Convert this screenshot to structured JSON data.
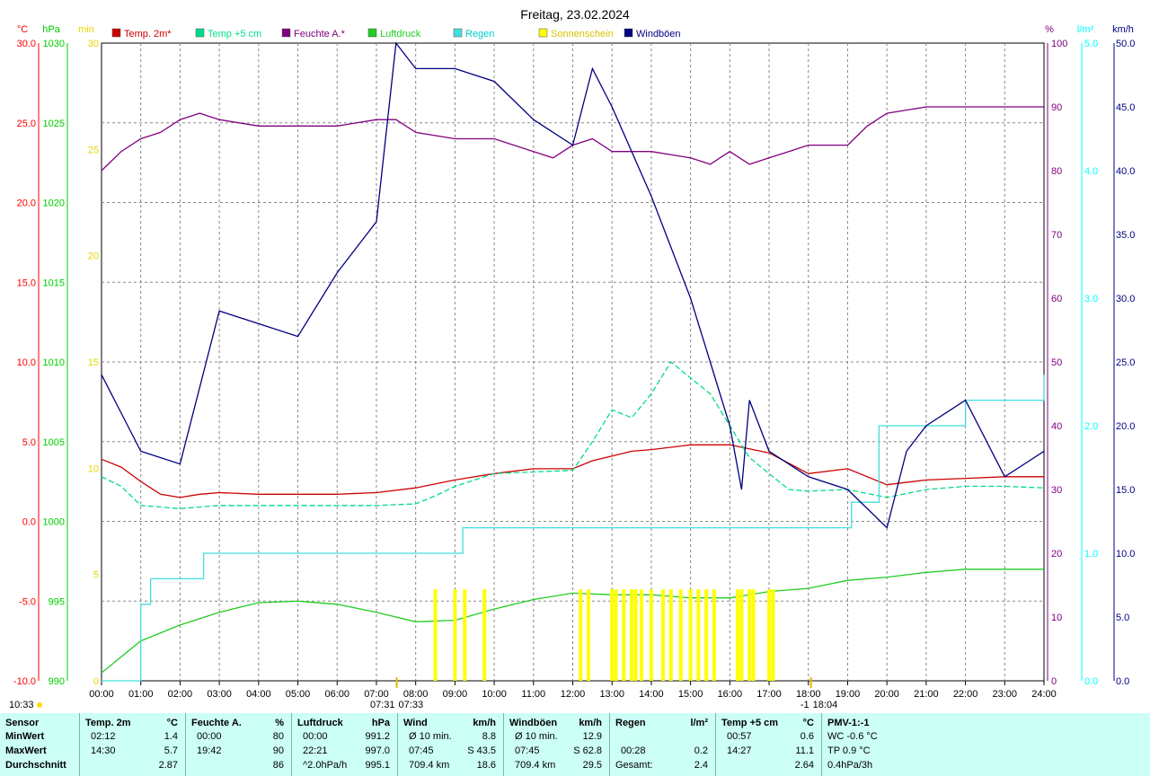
{
  "chart_data": {
    "type": "line",
    "title": "Freitag, 23.02.2024",
    "x_ticks": [
      "00:00",
      "01:00",
      "02:00",
      "03:00",
      "04:00",
      "05:00",
      "06:00",
      "07:00",
      "08:00",
      "09:00",
      "10:00",
      "11:00",
      "12:00",
      "13:00",
      "14:00",
      "15:00",
      "16:00",
      "17:00",
      "18:00",
      "19:00",
      "20:00",
      "21:00",
      "22:00",
      "23:00",
      "24:00"
    ],
    "x_range_hours": [
      0,
      24
    ],
    "grid": true,
    "legend_position": "top",
    "axes": {
      "temp": {
        "unit": "°C",
        "min": -10,
        "max": 30,
        "ticks": [
          "30.0",
          "25.0",
          "20.0",
          "15.0",
          "10.0",
          "5.0",
          "0.0",
          "-5.0",
          "-10.0"
        ],
        "color": "#ff0000"
      },
      "pressure": {
        "unit": "hPa",
        "min": 990,
        "max": 1030,
        "ticks": [
          "1030",
          "1025",
          "1020",
          "1015",
          "1010",
          "1005",
          "1000",
          "995",
          "990"
        ],
        "color": "#00cc00"
      },
      "sun": {
        "unit": "min",
        "min": 0,
        "max": 30,
        "ticks": [
          "30",
          "25",
          "20",
          "15",
          "10",
          "5",
          "0"
        ],
        "color": "#e6d600"
      },
      "humidity": {
        "unit": "%",
        "min": 0,
        "max": 100,
        "ticks": [
          "100",
          "90",
          "80",
          "70",
          "60",
          "50",
          "40",
          "30",
          "20",
          "10",
          "0"
        ],
        "color": "#800080"
      },
      "rain": {
        "unit": "l/m²",
        "min": 0,
        "max": 5,
        "ticks": [
          "5.0",
          "4.0",
          "3.0",
          "2.0",
          "1.0",
          "0.0"
        ],
        "color": "#00ffff"
      },
      "wind": {
        "unit": "km/h",
        "min": 0,
        "max": 50,
        "ticks": [
          "50.0",
          "45.0",
          "40.0",
          "35.0",
          "30.0",
          "25.0",
          "20.0",
          "15.0",
          "10.0",
          "5.0",
          "0.0"
        ],
        "color": "#000080"
      }
    },
    "sun_markers": {
      "sunrise": "07:31",
      "noon": "07:33",
      "sunset": "18:04",
      "sunset_prefix": "-1",
      "left_time": "10:33"
    },
    "series": [
      {
        "name": "Temp. 2m*",
        "color": "#cc0000",
        "axis": "temp",
        "x": [
          0,
          0.5,
          1,
          1.5,
          2,
          2.5,
          3,
          4,
          5,
          6,
          7,
          8,
          9,
          10,
          11,
          12,
          12.5,
          13,
          13.5,
          14,
          15,
          16,
          17,
          18,
          19,
          20,
          21,
          22,
          23,
          24
        ],
        "values": [
          3.9,
          3.4,
          2.5,
          1.7,
          1.5,
          1.7,
          1.8,
          1.7,
          1.7,
          1.7,
          1.8,
          2.1,
          2.6,
          3,
          3.3,
          3.3,
          3.8,
          4.1,
          4.4,
          4.5,
          4.8,
          4.8,
          4.3,
          3,
          3.3,
          2.3,
          2.6,
          2.7,
          2.8,
          2.8
        ]
      },
      {
        "name": "Temp +5 cm",
        "color": "#00dd88",
        "axis": "temp",
        "x": [
          0,
          0.5,
          1,
          1.5,
          2,
          3,
          4,
          5,
          6,
          7,
          8,
          8.5,
          9,
          10,
          11,
          12,
          12.5,
          13,
          13.5,
          14,
          14.5,
          15,
          15.5,
          16,
          16.5,
          17,
          17.5,
          18,
          19,
          20,
          21,
          22,
          23,
          24
        ],
        "values": [
          2.8,
          2.2,
          1,
          0.9,
          0.8,
          1,
          1,
          1,
          1,
          1,
          1.1,
          1.6,
          2.2,
          3,
          3.1,
          3.2,
          5,
          7,
          6.5,
          8,
          10,
          9,
          8,
          6,
          4,
          3,
          2,
          1.9,
          2,
          1.5,
          2,
          2.2,
          2.2,
          2.1
        ]
      },
      {
        "name": "Feuchte A.*",
        "color": "#800080",
        "axis": "humidity",
        "x": [
          0,
          0.5,
          1,
          1.5,
          2,
          2.5,
          3,
          4,
          5,
          6,
          7,
          7.5,
          8,
          9,
          10,
          11,
          11.5,
          12,
          12.5,
          13,
          14,
          15,
          15.5,
          16,
          16.5,
          17,
          17.5,
          18,
          19,
          19.5,
          20,
          21,
          22,
          23,
          24
        ],
        "values": [
          80,
          83,
          85,
          86,
          88,
          89,
          88,
          87,
          87,
          87,
          88,
          88,
          86,
          85,
          85,
          83,
          82,
          84,
          85,
          83,
          83,
          82,
          81,
          83,
          81,
          82,
          83,
          84,
          84,
          87,
          89,
          90,
          90,
          90,
          90
        ]
      },
      {
        "name": "Luftdruck",
        "color": "#22cc22",
        "axis": "pressure",
        "x": [
          0,
          1,
          2,
          3,
          4,
          5,
          6,
          7,
          8,
          9,
          10,
          11,
          12,
          13,
          14,
          15,
          16,
          17,
          18,
          19,
          20,
          21,
          22,
          23,
          24
        ],
        "values": [
          990.5,
          992.5,
          993.5,
          994.3,
          994.9,
          995,
          994.8,
          994.3,
          993.7,
          993.8,
          994.5,
          995.1,
          995.5,
          995.4,
          995.4,
          995.2,
          995.2,
          995.6,
          995.8,
          996.3,
          996.5,
          996.8,
          997,
          997,
          997
        ]
      },
      {
        "name": "Regen",
        "color": "#44dddd",
        "axis": "rain",
        "step": true,
        "x": [
          0,
          1,
          1.25,
          2.6,
          9.2,
          16.4,
          19.1,
          19.8,
          22,
          24
        ],
        "values": [
          0,
          0.6,
          0.8,
          1.0,
          1.2,
          1.2,
          1.4,
          2.0,
          2.2,
          2.4
        ]
      },
      {
        "name": "Sonnenschein",
        "color": "#ffff00",
        "axis": "sun",
        "type": "bar",
        "x": [
          8.5,
          9,
          9.25,
          9.75,
          12.2,
          12.4,
          13,
          13.1,
          13.3,
          13.5,
          13.6,
          13.75,
          14,
          14.3,
          14.5,
          14.75,
          15,
          15.2,
          15.4,
          15.6,
          16.2,
          16.3,
          16.5,
          16.6,
          17.0,
          17.1
        ],
        "values": [
          4.3,
          4.3,
          4.3,
          4.3,
          4.3,
          4.3,
          4.3,
          4.3,
          4.3,
          4.3,
          4.3,
          4.3,
          4.3,
          4.3,
          4.3,
          4.3,
          4.3,
          4.3,
          4.3,
          4.3,
          4.3,
          4.3,
          4.3,
          4.3,
          4.3,
          4.3
        ]
      },
      {
        "name": "Windböen",
        "color": "#000080",
        "axis": "wind",
        "x": [
          0,
          1,
          2,
          3,
          4,
          5,
          6,
          7,
          7.5,
          8,
          9,
          10,
          11,
          12,
          12.5,
          13,
          14,
          15,
          15.5,
          16,
          16.3,
          16.5,
          17,
          18,
          19,
          20,
          20.5,
          21,
          22,
          23,
          24
        ],
        "values": [
          24,
          18,
          17,
          29,
          28,
          27,
          32,
          36,
          50,
          48,
          48,
          47,
          44,
          42,
          48,
          45,
          38,
          30,
          25,
          20,
          15,
          22,
          18,
          16,
          15,
          12,
          18,
          20,
          22,
          16,
          18
        ]
      }
    ]
  },
  "stats": {
    "headers": {
      "sensor": "Sensor",
      "temp2m": {
        "name": "Temp. 2m",
        "unit": "°C"
      },
      "feuchte": {
        "name": "Feuchte A.",
        "unit": "%"
      },
      "luftdruck": {
        "name": "Luftdruck",
        "unit": "hPa"
      },
      "wind": {
        "name": "Wind",
        "unit": "km/h"
      },
      "windboeen": {
        "name": "Windböen",
        "unit": "km/h"
      },
      "regen": {
        "name": "Regen",
        "unit": "l/m²"
      },
      "temp5": {
        "name": "Temp +5 cm",
        "unit": "°C"
      },
      "pmv": {
        "name": "PMV-1:-1"
      }
    },
    "row_labels": [
      "MinWert",
      "MaxWert",
      "Durchschnitt"
    ],
    "temp2m": [
      [
        "02:12",
        "1.4"
      ],
      [
        "14:30",
        "5.7"
      ],
      [
        "",
        "2.87"
      ]
    ],
    "feuchte": [
      [
        "00:00",
        "80"
      ],
      [
        "19:42",
        "90"
      ],
      [
        "",
        "86"
      ]
    ],
    "luftdruck": [
      [
        "00:00",
        "991.2"
      ],
      [
        "22:21",
        "997.0"
      ],
      [
        "^2.0hPa/h",
        "995.1"
      ]
    ],
    "wind": [
      [
        "Ø 10 min.",
        "8.8"
      ],
      [
        "07:45",
        "S 43.5"
      ],
      [
        "709.4 km",
        "18.6"
      ]
    ],
    "windboeen": [
      [
        "Ø 10 min.",
        "12.9"
      ],
      [
        "07:45",
        "S 62.8"
      ],
      [
        "709.4 km",
        "29.5"
      ]
    ],
    "regen": [
      [
        "",
        ""
      ],
      [
        "00:28",
        "0.2"
      ],
      [
        "Gesamt:",
        "2.4"
      ]
    ],
    "temp5": [
      [
        "00:57",
        "0.6"
      ],
      [
        "14:27",
        "11.1"
      ],
      [
        "",
        "2.64"
      ]
    ],
    "pmv": [
      "WC -0.6 °C",
      "TP 0.9 °C",
      "0.4hPa/3h"
    ]
  }
}
